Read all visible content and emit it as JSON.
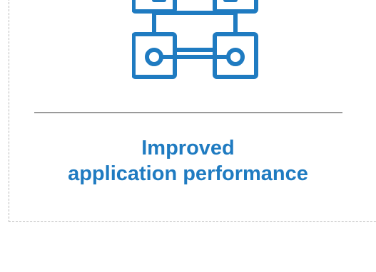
{
  "feature": {
    "icon": "connected-nodes-icon",
    "title_line1": "Improved",
    "title_line2": "application performance"
  },
  "colors": {
    "accent": "#1f7bc1",
    "divider": "#333333",
    "dashed_border": "#b9b9b9"
  }
}
